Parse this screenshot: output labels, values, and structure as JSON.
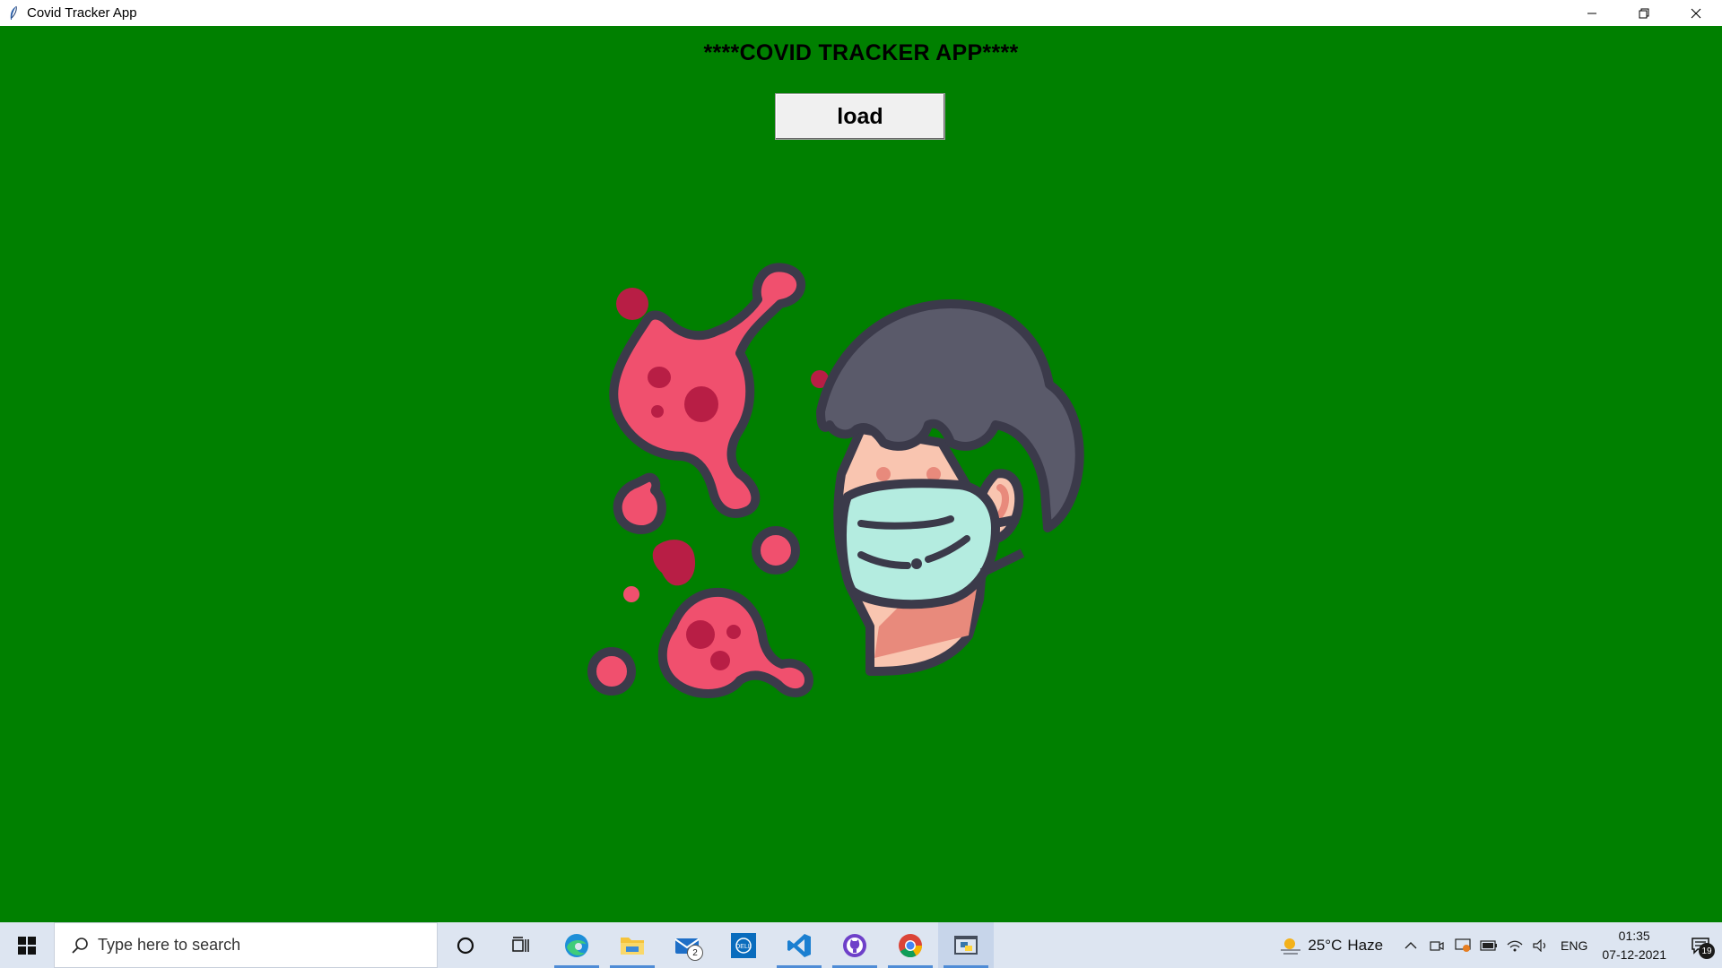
{
  "window": {
    "title": "Covid Tracker App",
    "controls": {
      "minimize": "─",
      "restore": "❐",
      "close": "✕"
    }
  },
  "app": {
    "heading": "****COVID TRACKER APP****",
    "load_button": "load",
    "background_color": "#008000",
    "illustration": "masked-man-with-virus-illustration"
  },
  "taskbar": {
    "search_placeholder": "Type here to search",
    "pinned_apps": [
      {
        "name": "cortana",
        "icon": "cortana-circle-icon"
      },
      {
        "name": "task-view",
        "icon": "task-view-icon"
      },
      {
        "name": "edge",
        "icon": "edge-icon"
      },
      {
        "name": "file-explorer",
        "icon": "folder-icon"
      },
      {
        "name": "mail",
        "icon": "mail-icon",
        "badge": "2"
      },
      {
        "name": "dell",
        "icon": "dell-icon"
      },
      {
        "name": "vscode",
        "icon": "vscode-icon"
      },
      {
        "name": "github-desktop",
        "icon": "github-icon"
      },
      {
        "name": "chrome",
        "icon": "chrome-icon"
      },
      {
        "name": "python-app",
        "icon": "python-window-icon"
      }
    ],
    "weather": {
      "temperature": "25°C",
      "condition": "Haze"
    },
    "language": "ENG",
    "time": "01:35",
    "date": "07-12-2021",
    "notification_count": "19"
  }
}
